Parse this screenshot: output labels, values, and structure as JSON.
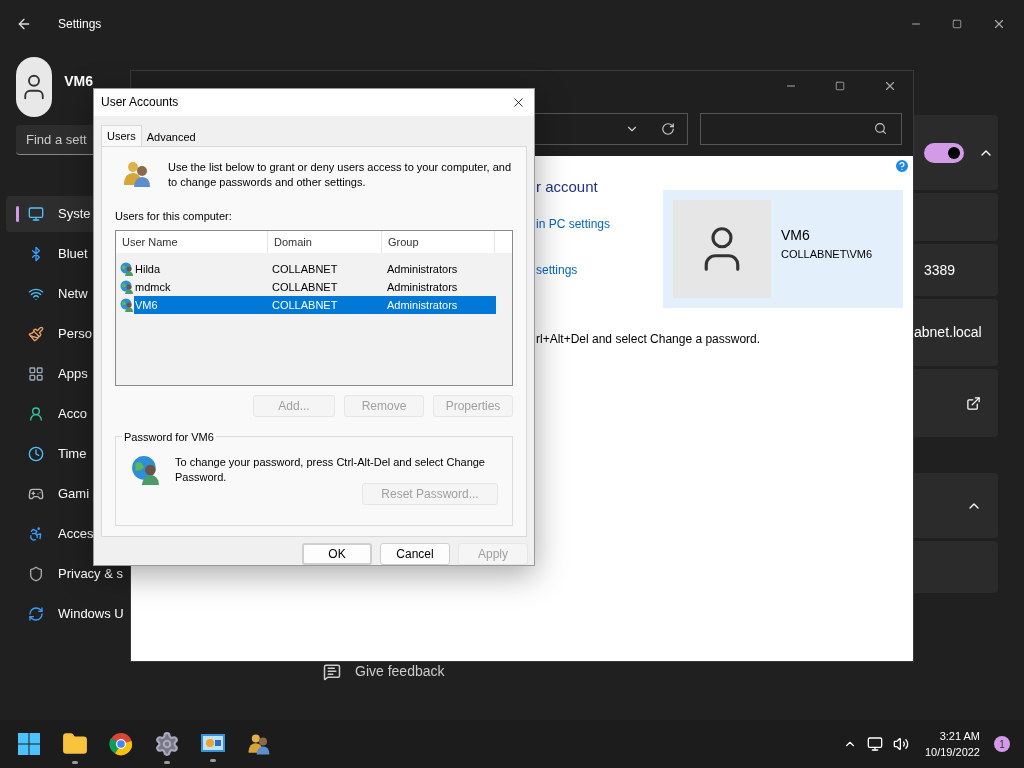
{
  "settings": {
    "title": "Settings",
    "profile": {
      "name": "VM6"
    },
    "search": {
      "placeholder": "Find a sett"
    },
    "nav": [
      {
        "label": "Syste",
        "selected": true
      },
      {
        "label": "Bluet",
        "selected": false
      },
      {
        "label": "Netw",
        "selected": false
      },
      {
        "label": "Perso",
        "selected": false
      },
      {
        "label": "Apps",
        "selected": false
      },
      {
        "label": "Acco",
        "selected": false
      },
      {
        "label": "Time",
        "selected": false
      },
      {
        "label": "Gami",
        "selected": false
      },
      {
        "label": "Acces",
        "selected": false
      },
      {
        "label": "Privacy & s",
        "selected": false
      },
      {
        "label": "Windows U",
        "selected": false
      }
    ],
    "cards": [
      {
        "kind": "toggle",
        "on": true,
        "expanded": true
      },
      {
        "kind": "empty"
      },
      {
        "kind": "value",
        "text": "3389"
      },
      {
        "kind": "value",
        "text": "abnet.local"
      },
      {
        "kind": "link"
      },
      {
        "kind": "expander",
        "expanded": true
      },
      {
        "kind": "empty"
      }
    ],
    "feedback": "Give feedback"
  },
  "control_panel": {
    "heading": "r account",
    "links": [
      "in PC settings",
      "settings"
    ],
    "user": {
      "name": "VM6",
      "account": "COLLABNET\\VM6"
    },
    "note": "rl+Alt+Del and select Change a password."
  },
  "dialog": {
    "title": "User Accounts",
    "tabs": [
      {
        "label": "Users",
        "selected": true
      },
      {
        "label": "Advanced",
        "selected": false
      }
    ],
    "intro": "Use the list below to grant or deny users access to your computer, and to change passwords and other settings.",
    "list_label": "Users for this computer:",
    "columns": [
      "User Name",
      "Domain",
      "Group"
    ],
    "rows": [
      {
        "cells": [
          "Hilda",
          "COLLABNET",
          "Administrators"
        ],
        "selected": false
      },
      {
        "cells": [
          "mdmck",
          "COLLABNET",
          "Administrators"
        ],
        "selected": false
      },
      {
        "cells": [
          "VM6",
          "COLLABNET",
          "Administrators"
        ],
        "selected": true
      }
    ],
    "list_buttons": [
      {
        "label": "Add...",
        "disabled": true
      },
      {
        "label": "Remove",
        "disabled": true
      },
      {
        "label": "Properties",
        "disabled": true
      }
    ],
    "password": {
      "title": "Password for VM6",
      "text": "To change your password, press Ctrl-Alt-Del and select Change Password.",
      "button": {
        "label": "Reset Password...",
        "disabled": true
      }
    },
    "buttons": [
      {
        "label": "OK",
        "disabled": false,
        "default": true
      },
      {
        "label": "Cancel",
        "disabled": false,
        "default": false
      },
      {
        "label": "Apply",
        "disabled": true,
        "default": false
      }
    ]
  },
  "taskbar": {
    "apps": [
      {
        "running": false
      },
      {
        "running": true
      },
      {
        "running": false
      },
      {
        "running": true
      },
      {
        "running": true
      },
      {
        "running": false
      }
    ],
    "time": "3:21 AM",
    "date": "10/19/2022",
    "notifications": "1"
  }
}
